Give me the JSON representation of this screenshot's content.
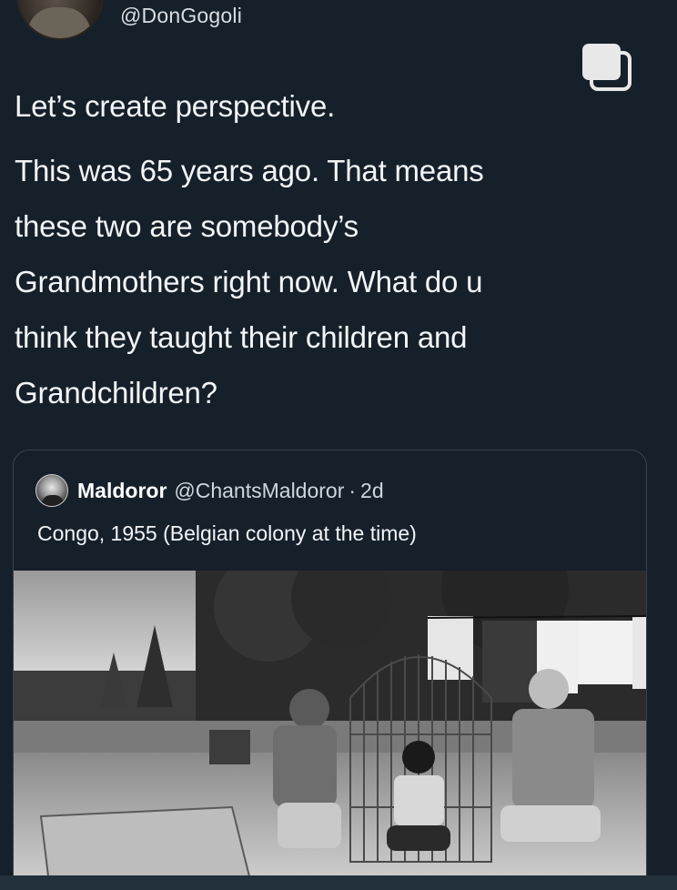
{
  "tweet": {
    "handle": "@DonGogoli",
    "lines": [
      "Let’s create perspective.",
      "This was 65 years ago. That means",
      "these two are somebody’s",
      "Grandmothers right now. What do u",
      "think they taught their children and",
      "Grandchildren?"
    ]
  },
  "quoted_tweet": {
    "name": "Maldoror",
    "handle": "@ChantsMaldoror",
    "separator": "·",
    "time": "2d",
    "text": "Congo, 1955 (Belgian colony at the time)"
  },
  "icons": {
    "copy": "copy-icon",
    "author_avatar": "avatar",
    "quoted_avatar": "avatar"
  },
  "colors": {
    "background": "#15202b",
    "text": "#f3f5f7",
    "secondary_text": "#cfd6dc",
    "border": "#38444d"
  }
}
